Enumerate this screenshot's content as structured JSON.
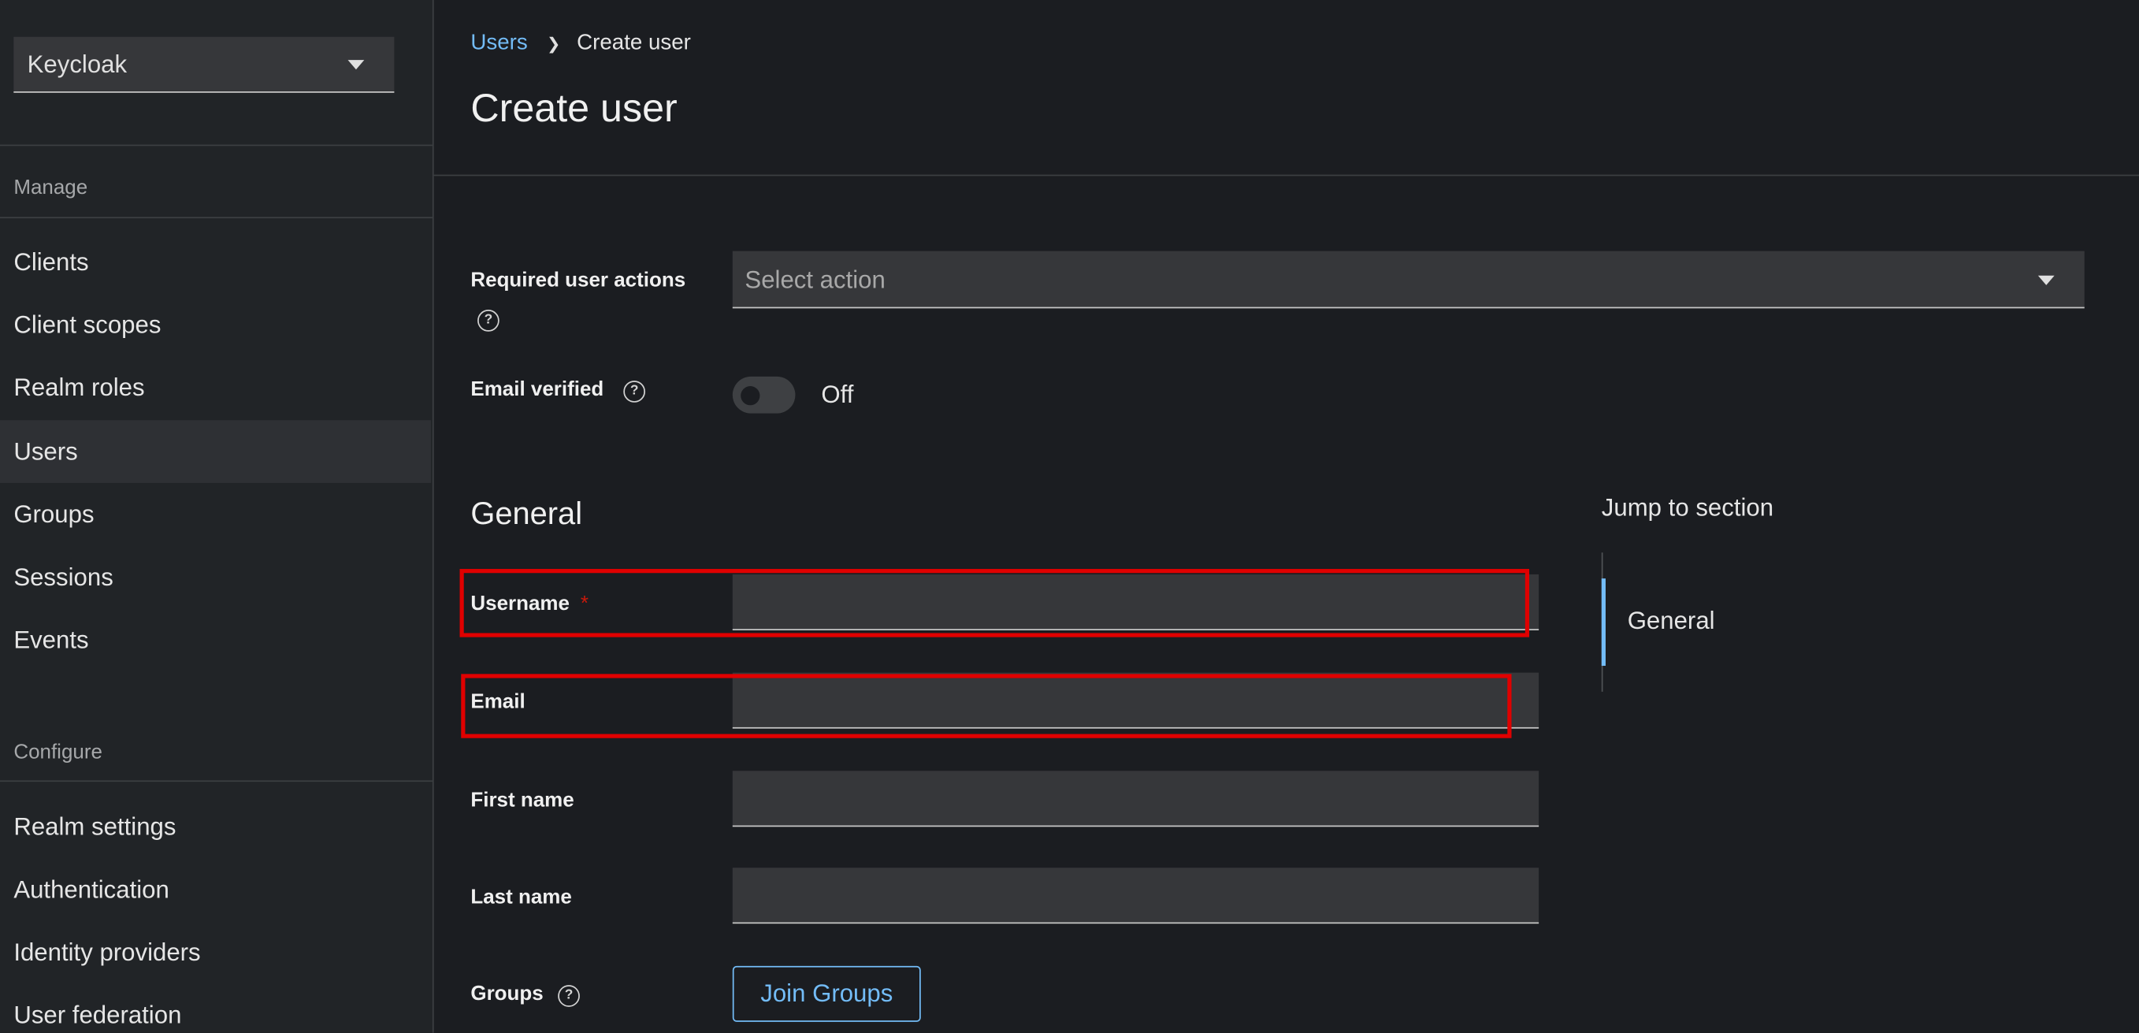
{
  "sidebar": {
    "realm_select": "Keycloak",
    "sections": {
      "manage": "Manage",
      "configure": "Configure"
    },
    "manage_items": [
      {
        "label": "Clients"
      },
      {
        "label": "Client scopes"
      },
      {
        "label": "Realm roles"
      },
      {
        "label": "Users",
        "active": true
      },
      {
        "label": "Groups"
      },
      {
        "label": "Sessions"
      },
      {
        "label": "Events"
      }
    ],
    "configure_items": [
      {
        "label": "Realm settings"
      },
      {
        "label": "Authentication"
      },
      {
        "label": "Identity providers"
      },
      {
        "label": "User federation"
      }
    ]
  },
  "breadcrumb": {
    "parent": "Users",
    "current": "Create user"
  },
  "page_title": "Create user",
  "form": {
    "required_actions": {
      "label": "Required user actions",
      "placeholder": "Select action"
    },
    "email_verified": {
      "label": "Email verified",
      "state": "Off"
    },
    "general_title": "General",
    "username": {
      "label": "Username",
      "required_mark": "*",
      "value": ""
    },
    "email": {
      "label": "Email",
      "value": ""
    },
    "first_name": {
      "label": "First name",
      "value": ""
    },
    "last_name": {
      "label": "Last name",
      "value": ""
    },
    "groups": {
      "label": "Groups",
      "button": "Join Groups"
    }
  },
  "jump_to_section": {
    "title": "Jump to section",
    "items": [
      {
        "label": "General",
        "active": true
      }
    ]
  },
  "icons": {
    "help": "question-circle-icon",
    "caret": "caret-down-icon",
    "breadcrumb_sep": "angle-right-icon"
  },
  "colors": {
    "link": "#73bcf7",
    "highlight": "#e00000",
    "background": "#1b1d21",
    "sidebar": "#212427"
  }
}
